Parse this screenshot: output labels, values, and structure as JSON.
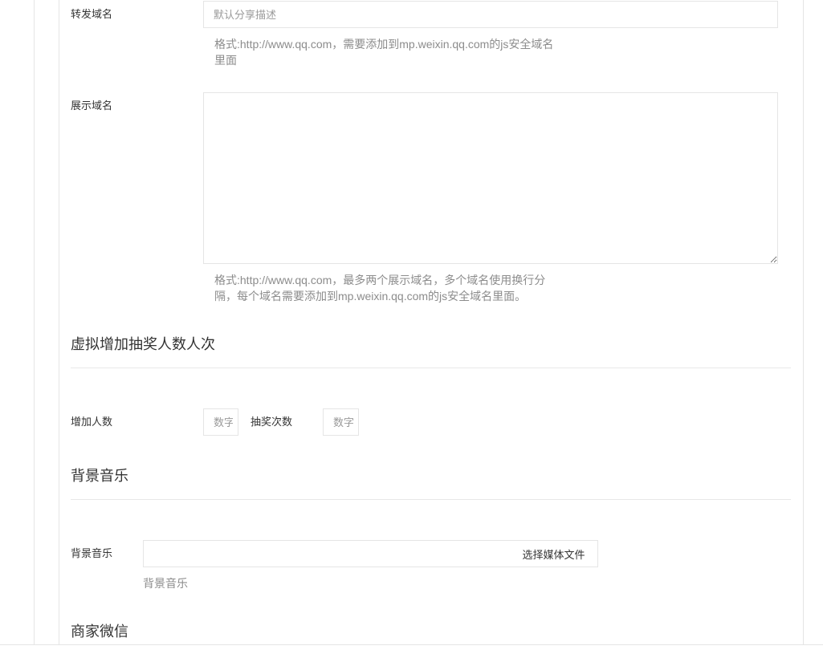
{
  "share_domain": {
    "label": "转发域名",
    "placeholder": "默认分享描述",
    "value": "",
    "help_line1": "格式:http://www.qq.com，需要添加到mp.weixin.qq.com的js安全域名",
    "help_line2": "里面"
  },
  "display_domain": {
    "label": "展示域名",
    "value": "",
    "help_line1": "格式:http://www.qq.com，最多两个展示域名，多个域名使用换行分",
    "help_line2": "隔，每个域名需要添加到mp.weixin.qq.com的js安全域名里面。"
  },
  "virtual_section": {
    "title": "虚拟增加抽奖人数人次",
    "add_people_label": "增加人数",
    "add_people_placeholder": "数字",
    "draw_times_label": "抽奖次数",
    "draw_times_placeholder": "数字"
  },
  "music_section": {
    "title": "背景音乐",
    "field_label": "背景音乐",
    "value": "",
    "button_label": "选择媒体文件",
    "help": "背景音乐"
  },
  "merchant_section": {
    "title": "商家微信"
  }
}
